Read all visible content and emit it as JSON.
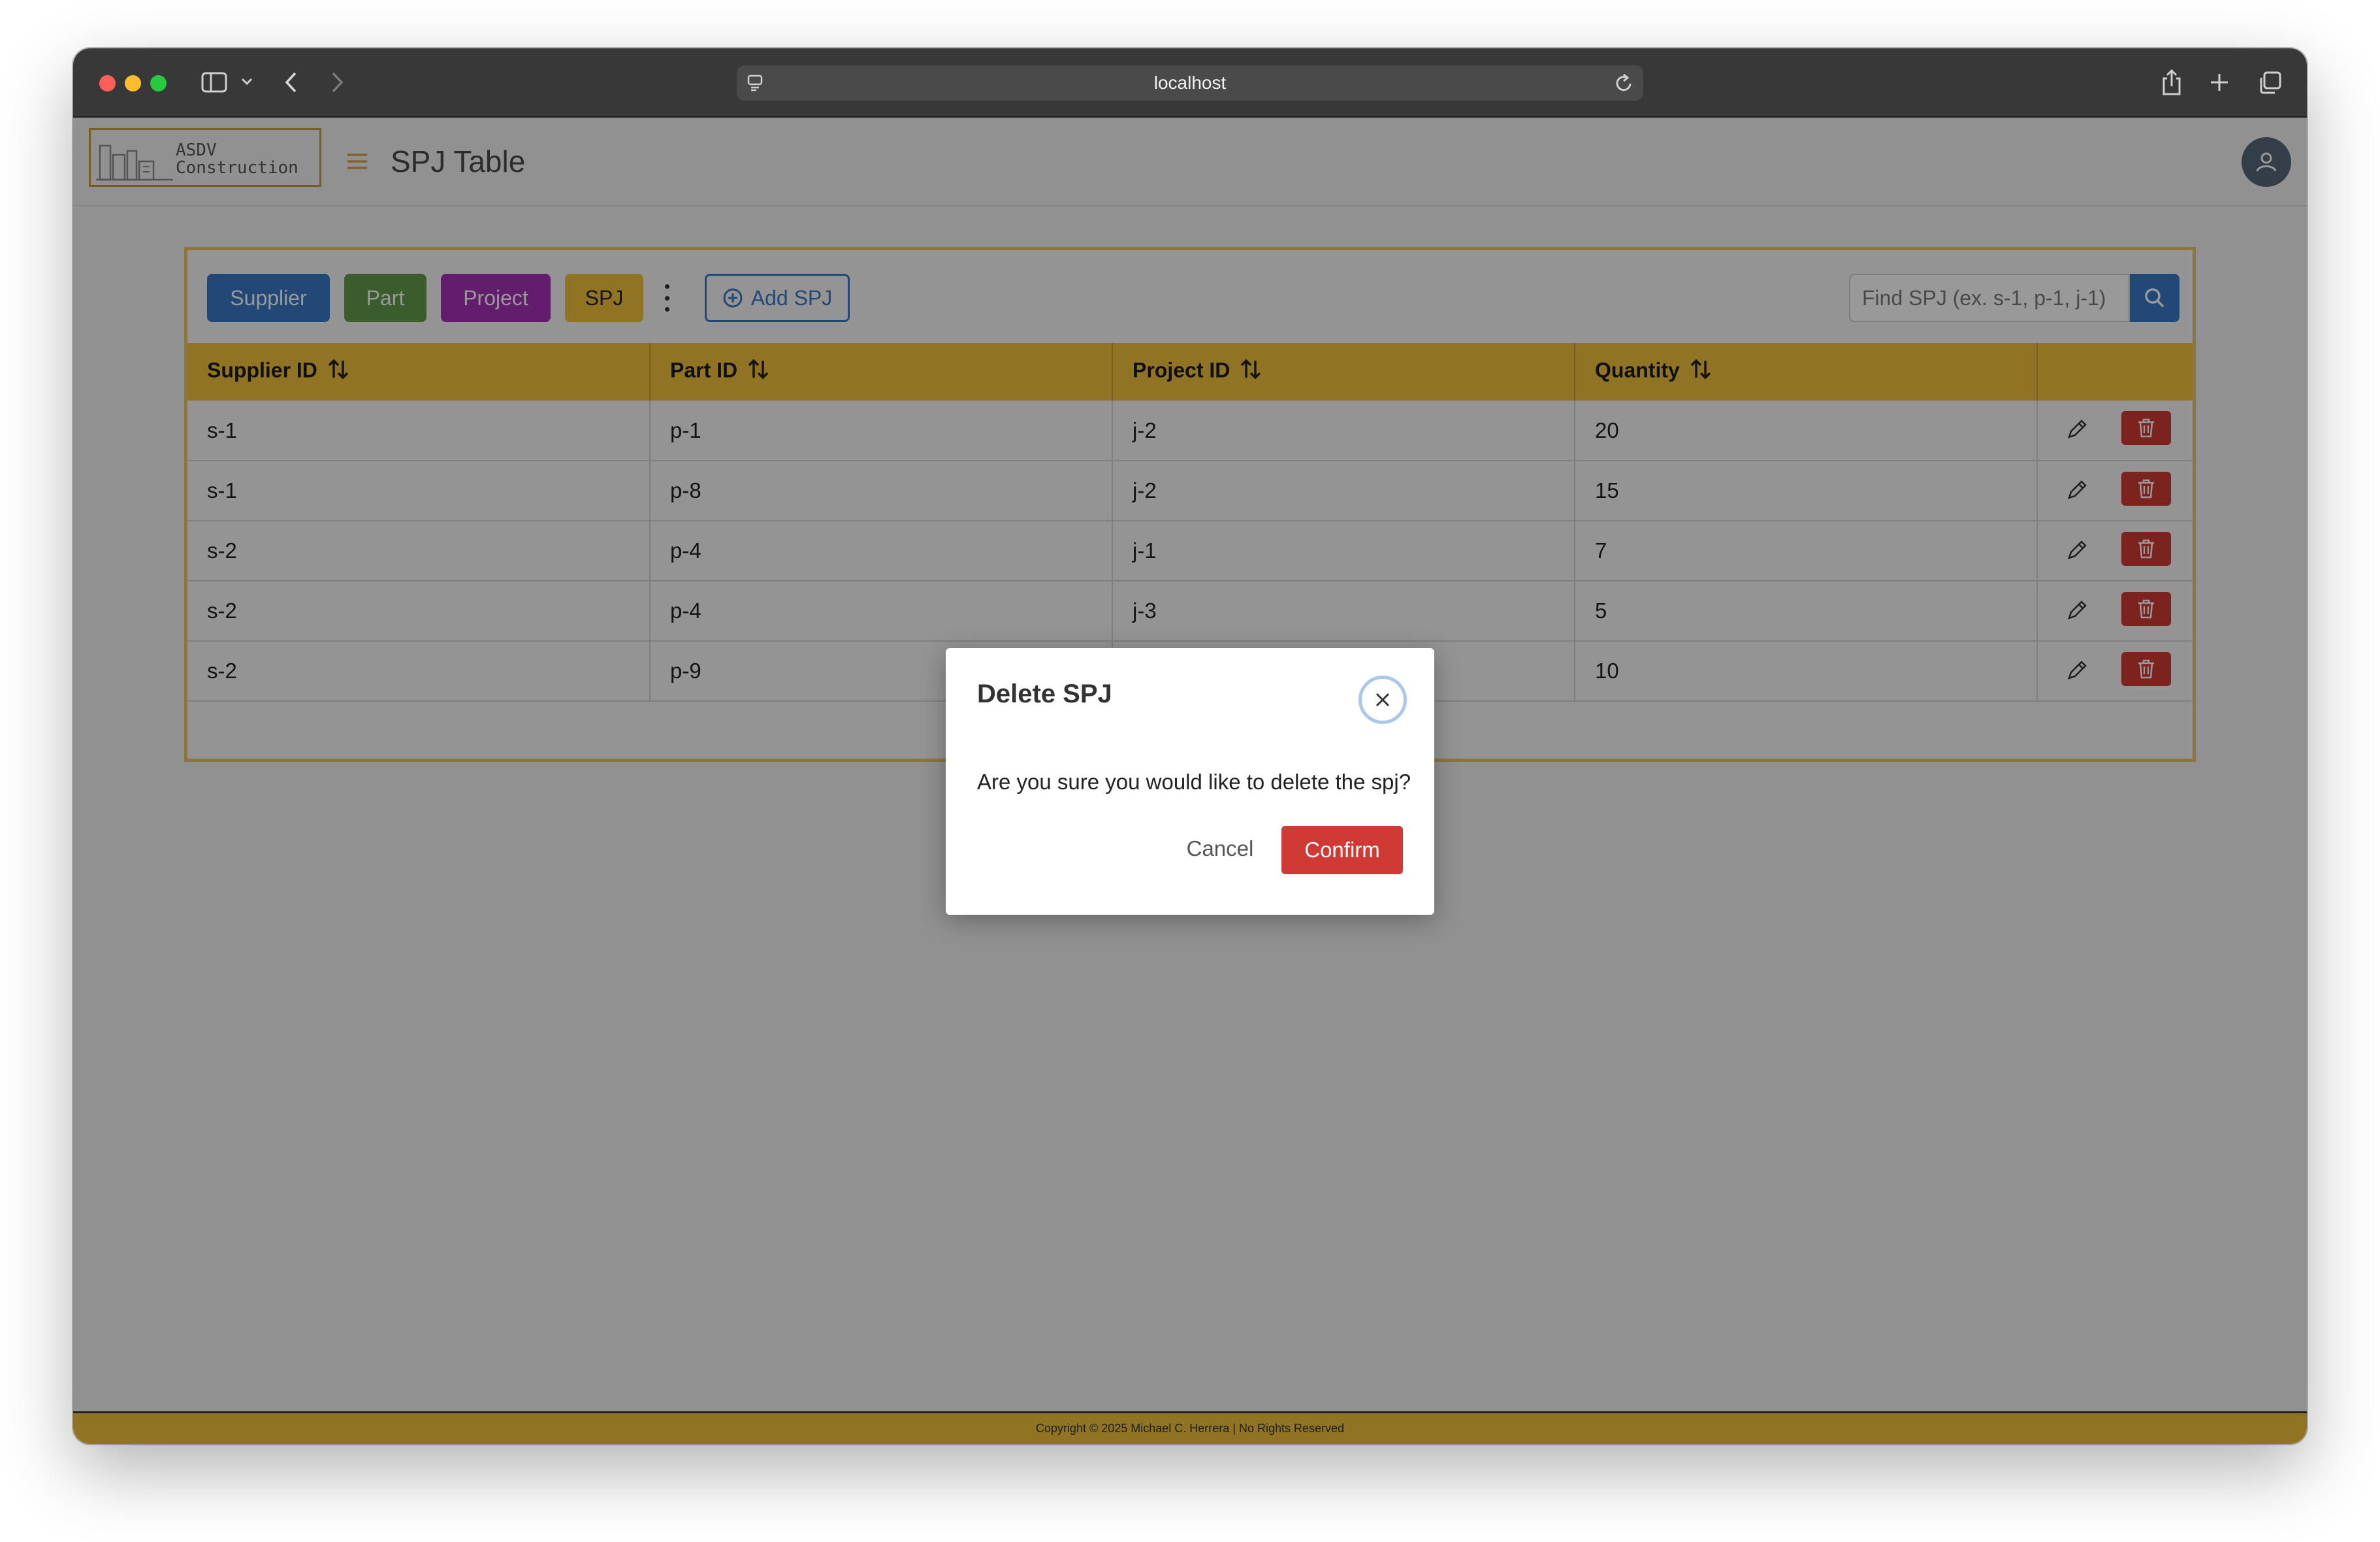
{
  "browser": {
    "url": "localhost"
  },
  "header": {
    "logo_line1": "ASDV",
    "logo_line2": "Construction",
    "title": "SPJ Table",
    "menu_icon": "hamburger-icon",
    "avatar_icon": "user-icon"
  },
  "toolbar": {
    "supplier_label": "Supplier",
    "part_label": "Part",
    "project_label": "Project",
    "spj_label": "SPJ",
    "add_label": "Add SPJ",
    "search_placeholder": "Find SPJ (ex. s-1, p-1, j-1)"
  },
  "colors": {
    "supplier": "#3a79c9",
    "part": "#63994a",
    "project": "#a331b5",
    "spj": "#f2c13b",
    "danger": "#cf3a34"
  },
  "table": {
    "columns": [
      "Supplier ID",
      "Part ID",
      "Project ID",
      "Quantity"
    ],
    "rows": [
      [
        "s-1",
        "p-1",
        "j-2",
        "20"
      ],
      [
        "s-1",
        "p-8",
        "j-2",
        "15"
      ],
      [
        "s-2",
        "p-4",
        "j-1",
        "7"
      ],
      [
        "s-2",
        "p-4",
        "j-3",
        "5"
      ],
      [
        "s-2",
        "p-9",
        "",
        "10"
      ]
    ]
  },
  "footer": {
    "text": "Copyright © 2025 Michael C. Herrera  |  No Rights Reserved"
  },
  "modal": {
    "title": "Delete SPJ",
    "message": "Are you sure you would like to delete the spj?",
    "cancel_label": "Cancel",
    "confirm_label": "Confirm"
  }
}
